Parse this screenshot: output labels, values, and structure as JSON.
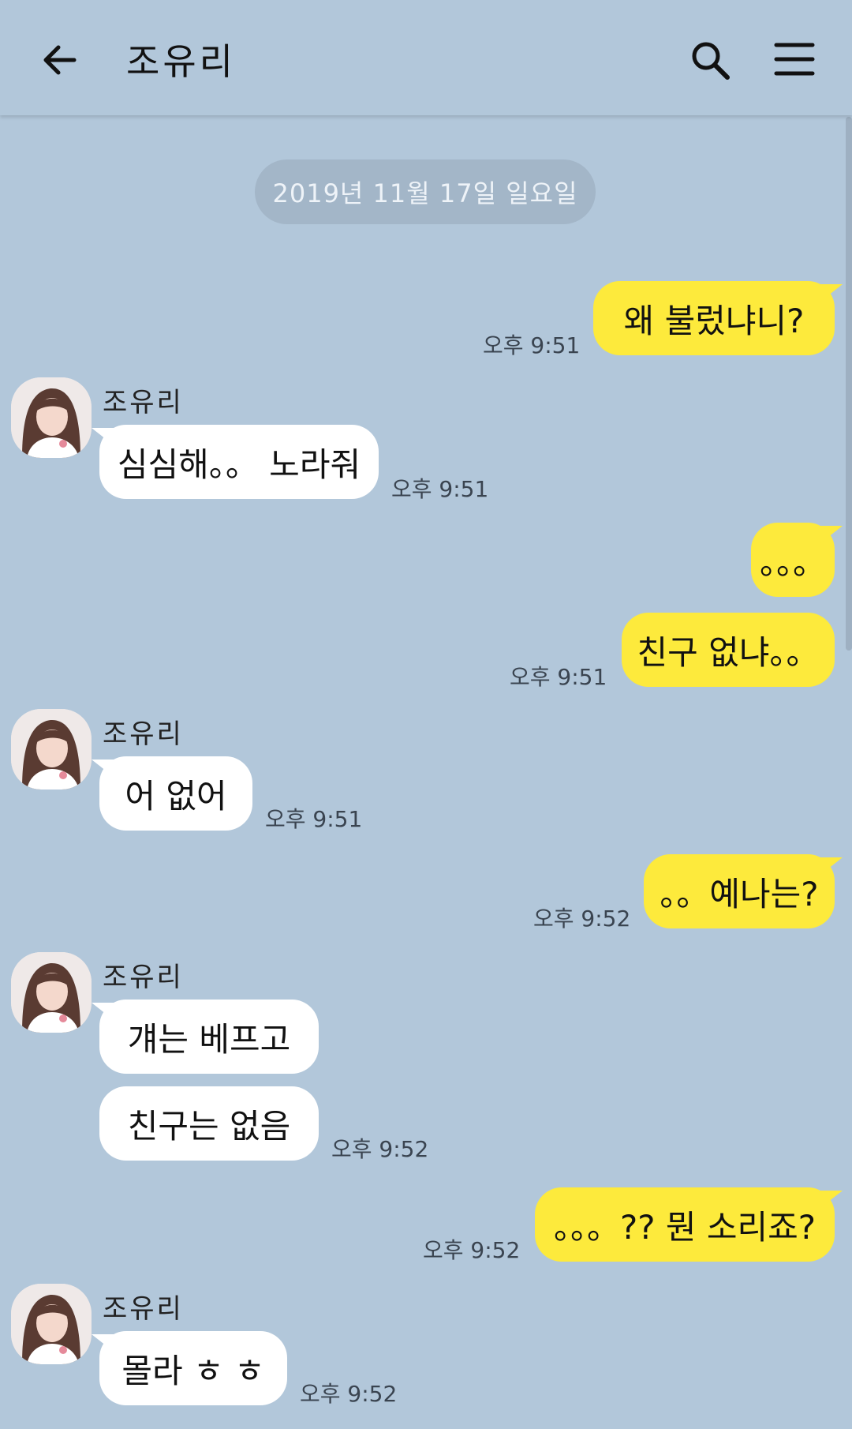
{
  "header": {
    "title": "조유리",
    "back_icon": "arrow-left-icon",
    "search_icon": "search-icon",
    "menu_icon": "hamburger-menu-icon"
  },
  "date_divider": "2019년 11월 17일 일요일",
  "colors": {
    "background": "#b2c7da",
    "outgoing_bubble": "#fdea3c",
    "incoming_bubble": "#ffffff"
  },
  "messages": [
    {
      "side": "out",
      "text": "왜 불렀냐니?",
      "time": "오후 9:51"
    },
    {
      "side": "in",
      "sender": "조유리",
      "text": "심심해。。 노라줘",
      "time": "오후 9:51"
    },
    {
      "side": "out",
      "text": "。。。"
    },
    {
      "side": "out",
      "text": "친구 없냐。。",
      "time": "오후 9:51"
    },
    {
      "side": "in",
      "sender": "조유리",
      "text": "어 없어",
      "time": "오후 9:51"
    },
    {
      "side": "out",
      "text": "。。예나는?",
      "time": "오후 9:52"
    },
    {
      "side": "in",
      "sender": "조유리",
      "text": "걔는 베프고"
    },
    {
      "side": "in",
      "text": "친구는 없음",
      "time": "오후 9:52"
    },
    {
      "side": "out",
      "text": "。。。?? 뭔 소리죠?",
      "time": "오후 9:52"
    },
    {
      "side": "in",
      "sender": "조유리",
      "text": "몰라 ㅎ ㅎ",
      "time": "오후 9:52"
    }
  ]
}
